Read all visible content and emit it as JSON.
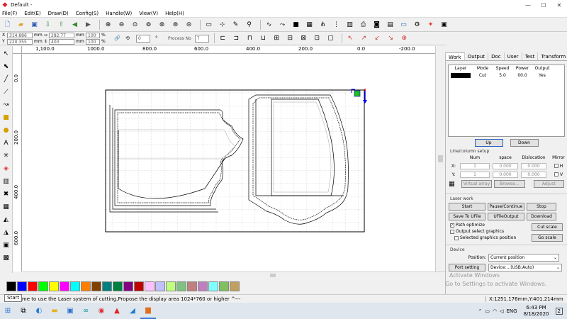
{
  "window": {
    "title": "Default -",
    "minimize": "—",
    "maximize": "☐",
    "close": "✕"
  },
  "menu": [
    "File(F)",
    "Edit(E)",
    "Draw(D)",
    "Config(S)",
    "Handle(W)",
    "View(V)",
    "Help(H)"
  ],
  "coords": {
    "x_value": "314.886",
    "y_value": "220.355",
    "x_unit": "mm",
    "y_unit": "mm",
    "w_value": "282.77",
    "h_value": "400",
    "w_unit": "mm",
    "h_unit": "mm",
    "scale_x": "100",
    "scale_y": "100",
    "pct_x": "%",
    "pct_y": "%",
    "rotate_value": "0",
    "process_label": "Process No",
    "process_value": "7"
  },
  "ruler_top": [
    "1,100.0",
    "1000.0",
    "800.0",
    "600.0",
    "400.0",
    "200.0",
    "0.0",
    "-200.0"
  ],
  "ruler_left": [
    "0.0",
    "200.0",
    "400.0",
    "600.0"
  ],
  "panel": {
    "tabs": [
      "Work",
      "Output",
      "Doc",
      "User",
      "Test",
      "Transform"
    ],
    "layer_headers": [
      "Layer",
      "Mode",
      "Speed",
      "Power",
      "Output"
    ],
    "layer_row": {
      "mode": "Cut",
      "speed": "5.0",
      "power": "00.0",
      "output": "Yes"
    },
    "up": "Up",
    "down": "Down",
    "line_col_title": "Line/column setup",
    "grid_headers": [
      "",
      "Num",
      "space",
      "Dislocation",
      "Mirror"
    ],
    "grid_rows": [
      {
        "axis": "X:",
        "num": "1",
        "space": "0.000",
        "disloc": "0.000",
        "mirror": "H"
      },
      {
        "axis": "Y:",
        "num": "1",
        "space": "0.000",
        "disloc": "0.000",
        "mirror": "V"
      }
    ],
    "virtual_array": "Virtual array",
    "browse": "Browse...",
    "adjust": "Adjust",
    "laser_work_title": "Laser work",
    "start": "Start",
    "pause": "Pause/Continue",
    "stop": "Stop",
    "save_to_file": "Save To UFile",
    "u_file_output": "UFileOutput",
    "download": "Download",
    "path_optimize": "Path optimize",
    "output_select": "Output select graphics",
    "selected_pos": "Selected graphics position",
    "cut_scale": "Cut scale",
    "go_scale": "Go scale",
    "device_title": "Device",
    "position_label": "Position:",
    "position_value": "Current position",
    "port_setting": "Port setting",
    "device_value": "Device:...(USB:Auto)"
  },
  "palette": [
    "#000000",
    "#0000ff",
    "#ff0000",
    "#00ff00",
    "#ffff00",
    "#ff00ff",
    "#00ffff",
    "#ff8000",
    "#804000",
    "#008080",
    "#008040",
    "#800080",
    "#c00000",
    "#ffc0ff",
    "#c0c0ff",
    "#c0ff80",
    "#80c080",
    "#c08080",
    "#c080c0",
    "#80ffff",
    "#80c060",
    "#c0a060"
  ],
  "status": {
    "message": "Welcome to use the Laser system of cutting,Propose the display area 1024*760 or higher ^---",
    "coords": "X:1251.176mm,Y:401.214mm"
  },
  "start_tooltip": "Start",
  "watermark": {
    "line1": "Activate Windows",
    "line2": "Go to Settings to activate Windows."
  },
  "taskbar": {
    "lang": "ENG",
    "time": "6:43 PM",
    "date": "8/18/2020",
    "notify": "2"
  }
}
